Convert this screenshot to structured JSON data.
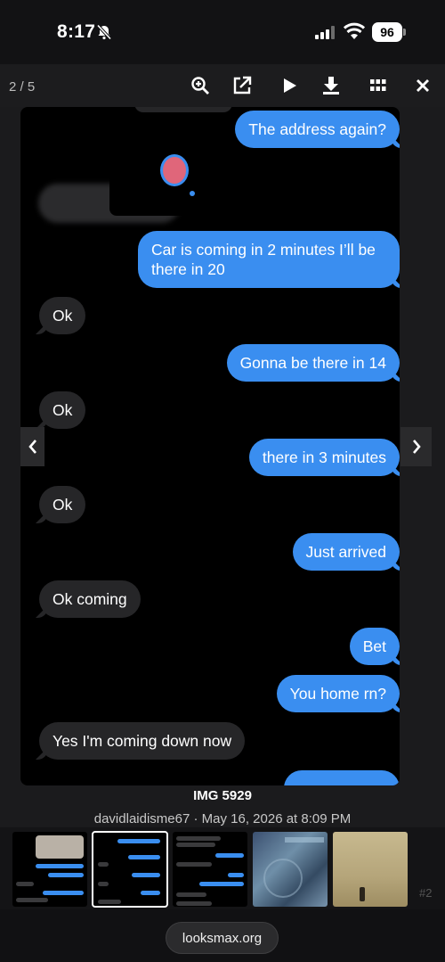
{
  "status_bar": {
    "time": "8:17",
    "battery": "96"
  },
  "toolbar": {
    "counter": "2 / 5",
    "icons": [
      "zoom-in-icon",
      "external-link-icon",
      "play-icon",
      "download-icon",
      "grid-icon",
      "close-icon"
    ]
  },
  "messages": [
    {
      "side": "out",
      "text": "The address again?"
    },
    {
      "side": "out",
      "text": "Car is coming in 2 minutes I’ll be there in 20"
    },
    {
      "side": "in",
      "text": "Ok"
    },
    {
      "side": "out",
      "text": "Gonna be there in 14"
    },
    {
      "side": "in",
      "text": "Ok"
    },
    {
      "side": "out",
      "text": "there in 3 minutes"
    },
    {
      "side": "in",
      "text": "Ok"
    },
    {
      "side": "out",
      "text": "Just arrived"
    },
    {
      "side": "in",
      "text": "Ok coming"
    },
    {
      "side": "out",
      "text": "Bet"
    },
    {
      "side": "out",
      "text": "You home rn?"
    },
    {
      "side": "in",
      "text": "Yes I'm coming down now"
    }
  ],
  "caption": {
    "title": "IMG 5929",
    "meta": "davidlaidisme67 · May 16, 2026 at 8:09 PM"
  },
  "thumbnails": {
    "active_index": 1,
    "more_label": "#2"
  },
  "footer": {
    "url": "looksmax.org"
  },
  "colors": {
    "outgoing_bubble": "#3a8ef0",
    "incoming_bubble": "#262628",
    "background": "#000000"
  }
}
